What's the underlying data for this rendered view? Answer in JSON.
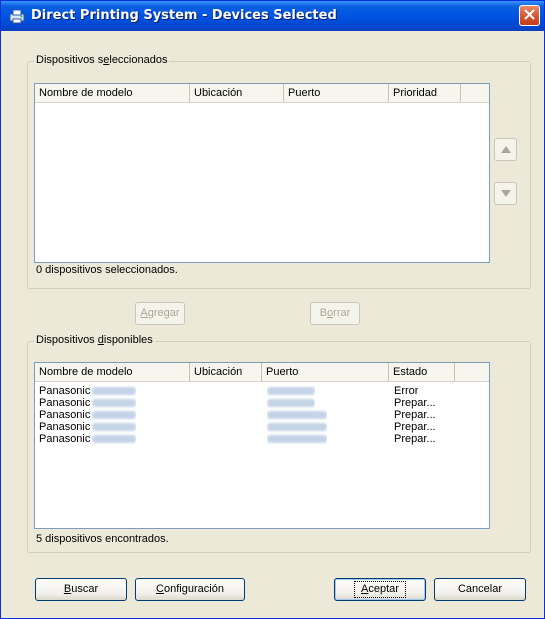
{
  "window": {
    "title": "Direct Printing System - Devices Selected"
  },
  "selected_group": {
    "legend": "Dispositivos seleccionados",
    "columns": [
      "Nombre de modelo",
      "Ubicación",
      "Puerto",
      "Prioridad"
    ],
    "status": "0 dispositivos seleccionados."
  },
  "actions": {
    "add_label": "Agregar",
    "delete_label": "Borrar"
  },
  "available_group": {
    "legend": "Dispositivos disponibles",
    "columns": [
      "Nombre de modelo",
      "Ubicación",
      "Puerto",
      "Estado"
    ],
    "rows": [
      {
        "model": "Panasonic",
        "status": "Error"
      },
      {
        "model": "Panasonic",
        "status": "Prepar..."
      },
      {
        "model": "Panasonic",
        "status": "Prepar..."
      },
      {
        "model": "Panasonic",
        "status": "Prepar..."
      },
      {
        "model": "Panasonic",
        "status": "Prepar..."
      }
    ],
    "status": "5 dispositivos encontrados."
  },
  "footer": {
    "search_label": "Buscar",
    "config_label": "Configuración",
    "accept_label": "Aceptar",
    "cancel_label": "Cancelar"
  },
  "icons": {
    "app": "printer-system-icon",
    "close": "close-icon",
    "up": "arrow-up-icon",
    "down": "arrow-down-icon"
  },
  "colors": {
    "title_bar": "#0054E3",
    "dialog_bg": "#ECE9D8",
    "close_button": "#D6542E"
  }
}
